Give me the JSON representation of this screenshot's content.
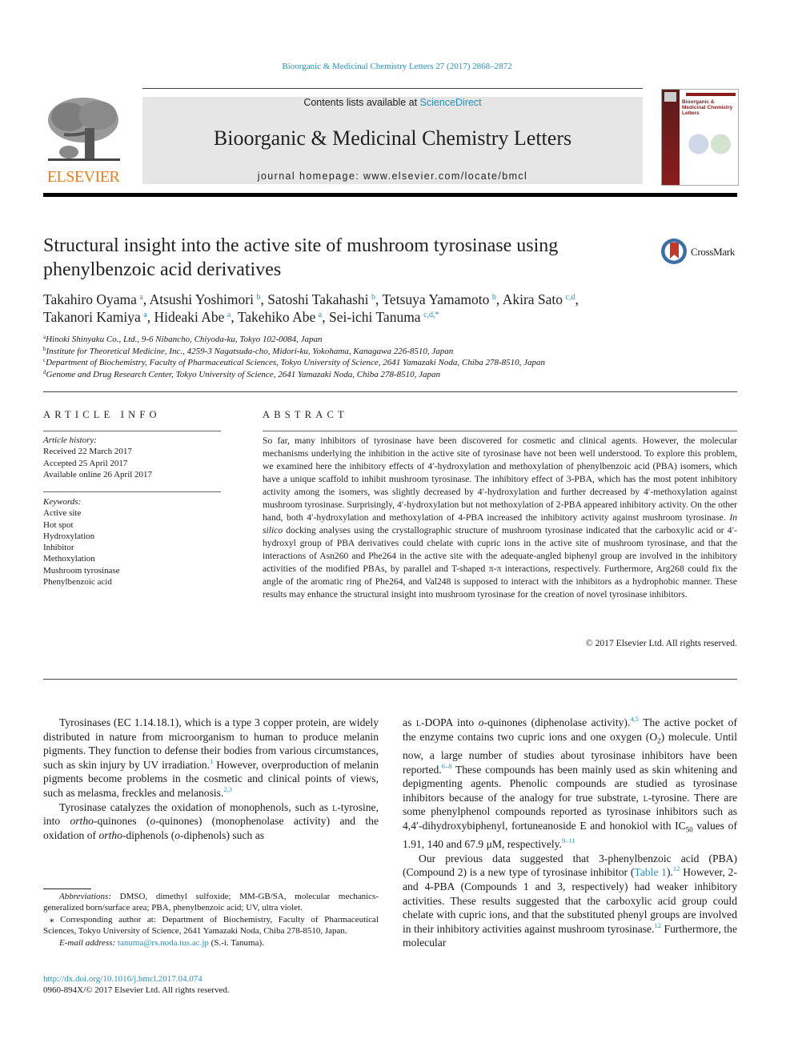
{
  "header": {
    "citation": "Bioorganic & Medicinal Chemistry Letters 27 (2017) 2868–2872",
    "contents_prefix": "Contents lists available at ",
    "contents_link": "ScienceDirect",
    "journal_title": "Bioorganic & Medicinal Chemistry Letters",
    "homepage": "journal homepage: www.elsevier.com/locate/bmcl",
    "publisher_logo_text": "ELSEVIER",
    "cover_title": "Bioorganic & Medicinal Chemistry Letters",
    "crossmark_label": "CrossMark"
  },
  "colors": {
    "link": "#2a8fbf",
    "elsevier_orange": "#f07c1c",
    "cover_red": "#8a1c1c",
    "banner_gray": "#e6e6e6"
  },
  "article": {
    "title": "Structural insight into the active site of mushroom tyrosinase using phenylbenzoic acid derivatives",
    "authors": [
      {
        "name": "Takahiro Oyama",
        "aff": "a"
      },
      {
        "name": "Atsushi Yoshimori",
        "aff": "b"
      },
      {
        "name": "Satoshi Takahashi",
        "aff": "b"
      },
      {
        "name": "Tetsuya Yamamoto",
        "aff": "b"
      },
      {
        "name": "Akira Sato",
        "aff": "c,d"
      },
      {
        "name": "Takanori Kamiya",
        "aff": "a"
      },
      {
        "name": "Hideaki Abe",
        "aff": "a"
      },
      {
        "name": "Takehiko Abe",
        "aff": "a"
      },
      {
        "name": "Sei-ichi Tanuma",
        "aff": "c,d,*"
      }
    ],
    "affiliations": [
      {
        "key": "a",
        "text": "Hinoki Shinyaku Co., Ltd., 9-6 Nibancho, Chiyoda-ku, Tokyo 102-0084, Japan"
      },
      {
        "key": "b",
        "text": "Institute for Theoretical Medicine, Inc., 4259-3 Nagatsuda-cho, Midori-ku, Yokohama, Kanagawa 226-8510, Japan"
      },
      {
        "key": "c",
        "text": "Department of Biochemistry, Faculty of Pharmaceutical Sciences, Tokyo University of Science, 2641 Yamazaki Noda, Chiba 278-8510, Japan"
      },
      {
        "key": "d",
        "text": "Genome and Drug Research Center, Tokyo University of Science, 2641 Yamazaki Noda, Chiba 278-8510, Japan"
      }
    ]
  },
  "article_info": {
    "heading": "ARTICLE INFO",
    "history_label": "Article history:",
    "history": [
      "Received 22 March 2017",
      "Accepted 25 April 2017",
      "Available online 26 April 2017"
    ],
    "keywords_label": "Keywords:",
    "keywords": [
      "Active site",
      "Hot spot",
      "Hydroxylation",
      "Inhibitor",
      "Methoxylation",
      "Mushroom tyrosinase",
      "Phenylbenzoic acid"
    ]
  },
  "abstract": {
    "heading": "ABSTRACT",
    "part1": "So far, many inhibitors of tyrosinase have been discovered for cosmetic and clinical agents. However, the molecular mechanisms underlying the inhibition in the active site of tyrosinase have not been well understood. To explore this problem, we examined here the inhibitory effects of 4′-hydroxylation and methoxylation of phenylbenzoic acid (PBA) isomers, which have a unique scaffold to inhibit mushroom tyrosinase. The inhibitory effect of 3-PBA, which has the most potent inhibitory activity among the isomers, was slightly decreased by 4′-hydroxylation and further decreased by 4′-methoxylation against mushroom tyrosinase. Surprisingly, 4′-hydroxylation but not methoxylation of 2-PBA appeared inhibitory activity. On the other hand, both 4′-hydroxylation and methoxylation of 4-PBA increased the inhibitory activity against mushroom tyrosinase. ",
    "italic": "In silico",
    "part2": " docking analyses using the crystallographic structure of mushroom tyrosinase indicated that the carboxylic acid or 4′-hydroxyl group of PBA derivatives could chelate with cupric ions in the active site of mushroom tyrosinase, and that the interactions of Asn260 and Phe264 in the active site with the adequate-angled biphenyl group are involved in the inhibitory activities of the modified PBAs, by parallel and T-shaped π-π interactions, respectively. Furthermore, Arg268 could fix the angle of the aromatic ring of Phe264, and Val248 is supposed to interact with the inhibitors as a hydrophobic manner. These results may enhance the structural insight into mushroom tyrosinase for the creation of novel tyrosinase inhibitors.",
    "copyright": "© 2017 Elsevier Ltd. All rights reserved."
  },
  "body": {
    "p1_a": "Tyrosinases (EC 1.14.18.1), which is a type 3 copper protein, are widely distributed in nature from microorganism to human to produce melanin pigments. They function to defense their bodies from various circumstances, such as skin injury by UV irradiation.",
    "p1_ref1": "1",
    "p1_b": " However, overproduction of melanin pigments become problems in the cosmetic and clinical points of views, such as melasma, freckles and melanosis.",
    "p1_ref2": "2,3",
    "p2_a": "Tyrosinase catalyzes the oxidation of monophenols, such as ",
    "p2_l1": "l",
    "p2_b": "-tyrosine, into ",
    "p2_i1": "ortho",
    "p2_c": "-quinones (",
    "p2_i2": "o",
    "p2_d": "-quinones) (monophenolase activity) and the oxidation of ",
    "p2_i3": "ortho",
    "p2_e": "-diphenols (",
    "p2_i4": "o",
    "p2_f": "-diphenols) such as ",
    "p2_l2": "l",
    "p2_g": "-DOPA into ",
    "p2_i5": "o",
    "p2_h": "-quinones (diphenolase activity).",
    "p2_ref1": "4,5",
    "p2_i": " The active pocket of the enzyme contains two cupric ions and one oxygen (O",
    "p2_sub": "2",
    "p2_j": ") molecule. Until now, a large number of studies about tyrosinase inhibitors have been reported.",
    "p2_ref2": "6–8",
    "p2_k": " These compounds has been mainly used as skin whitening and depigmenting agents. Phenolic compounds are studied as tyrosinase inhibitors because of the analogy for true substrate, ",
    "p2_l3": "l",
    "p2_m": "-tyrosine. There are some phenylphenol compounds reported as tyrosinase inhibitors such as 4,4′-dihydroxybiphenyl, fortuneanoside E and honokiol with IC",
    "p2_sub2": "50",
    "p2_n": " values of 1.91, 140 and 67.9 μM, respectively.",
    "p2_ref3": "9–11",
    "p3_a": "Our previous data suggested that 3-phenylbenzoic acid (PBA) (Compound 2) is a new type of tyrosinase inhibitor (",
    "p3_link": "Table 1",
    "p3_b": ").",
    "p3_ref1": "12",
    "p3_c": " However, 2- and 4-PBA (Compounds 1 and 3, respectively) had weaker inhibitory activities. These results suggested that the carboxylic acid group could chelate with cupric ions, and that the substituted phenyl groups are involved in their inhibitory activities against mushroom tyrosinase.",
    "p3_ref2": "12",
    "p3_d": " Furthermore, the molecular"
  },
  "footnotes": {
    "abbrev_label": "Abbreviations:",
    "abbrev_text": " DMSO, dimethyl sulfoxide; MM-GB/SA, molecular mechanics-generalized born/surface area; PBA, phenylbenzoic acid; UV, ultra violet.",
    "corresponding": "⁎ Corresponding author at: Department of Biochemistry, Faculty of Pharmaceutical Sciences, Tokyo University of Science, 2641 Yamazaki Noda, Chiba 278-8510, Japan.",
    "email_label": "E-mail address:",
    "email": "tanuma@rs.noda.tus.ac.jp",
    "email_suffix": " (S.-i. Tanuma).",
    "doi": "http://dx.doi.org/10.1016/j.bmcl.2017.04.074",
    "issn": "0960-894X/© 2017 Elsevier Ltd. All rights reserved."
  }
}
